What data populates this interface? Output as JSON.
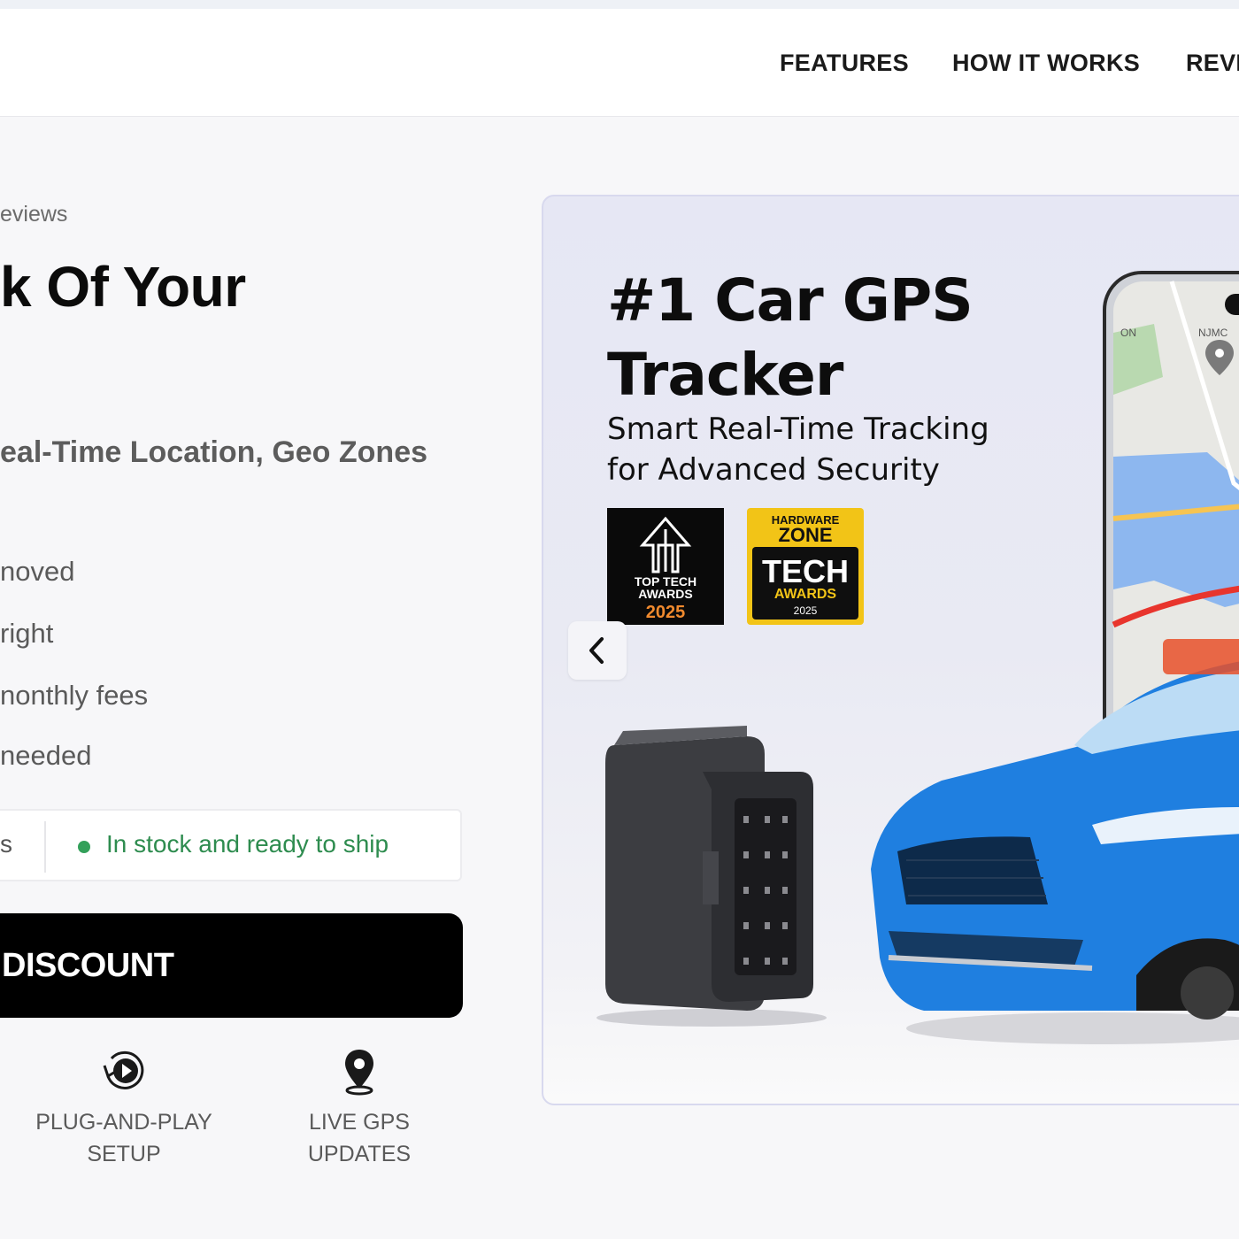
{
  "nav": {
    "links": [
      "FEATURES",
      "HOW IT WORKS",
      "REVI"
    ]
  },
  "hero": {
    "reviews_text": "eviews",
    "title": "k Of Your",
    "subtitle": "eal-Time Location, Geo Zones",
    "features": [
      "noved",
      "right",
      "nonthly fees",
      "needed"
    ],
    "stock_left": "s",
    "stock_text": "In stock and ready to ship",
    "cta_label": "DISCOUNT",
    "badges": [
      {
        "icon": "play-circle-icon",
        "line1": "PLUG-AND-PLAY",
        "line2": "SETUP"
      },
      {
        "icon": "map-pin-icon",
        "line1": "LIVE GPS",
        "line2": "UPDATES"
      }
    ]
  },
  "banner": {
    "headline_line1": "#1 Car GPS",
    "headline_line2": "Tracker",
    "sub_line1": "Smart Real-Time Tracking",
    "sub_line2": "for Advanced Security",
    "award1": {
      "l1": "TOP TECH",
      "l2": "AWARDS",
      "year": "2025"
    },
    "award2": {
      "l1": "HARDWARE",
      "l2": "ZONE",
      "l3": "TECH",
      "l4": "AWARDS",
      "year": "2025"
    },
    "prev_icon": "chevron-left-icon",
    "map_labels": [
      "ON",
      "NJMC"
    ]
  },
  "colors": {
    "accent": "#000000",
    "stock_green": "#33a05a",
    "car_blue": "#1f7fe0",
    "award_gold": "#f2c417"
  }
}
